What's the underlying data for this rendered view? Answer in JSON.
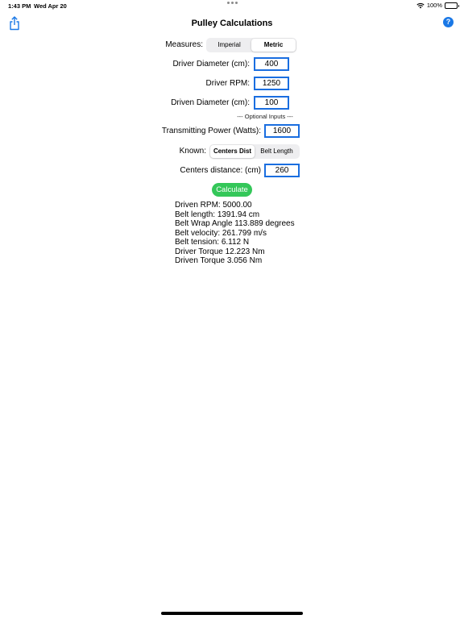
{
  "status": {
    "time": "1:43 PM",
    "date": "Wed Apr 20",
    "battery": "100%"
  },
  "nav": {
    "title": "Pulley Calculations",
    "help_label": "?"
  },
  "measures": {
    "label": "Measures:",
    "options": [
      "Imperial",
      "Metric"
    ],
    "selected": "Metric"
  },
  "inputs": {
    "driver_diameter": {
      "label": "Driver Diameter (cm):",
      "value": "400"
    },
    "driver_rpm": {
      "label": "Driver RPM:",
      "value": "1250"
    },
    "driven_diameter": {
      "label": "Driven Diameter (cm):",
      "value": "100"
    },
    "optional_note": "--- Optional Inputs ---",
    "transmitting_power": {
      "label": "Transmitting Power (Watts):",
      "value": "1600"
    }
  },
  "known": {
    "label": "Known:",
    "options": [
      "Centers Dist",
      "Belt Length"
    ],
    "selected": "Centers Dist"
  },
  "centers_distance": {
    "label": "Centers distance: (cm)",
    "value": "260"
  },
  "calculate_label": "Calculate",
  "results": [
    "Driven RPM: 5000.00",
    "Belt length: 1391.94 cm",
    "Belt Wrap Angle 113.889 degrees",
    "Belt velocity: 261.799 m/s",
    "Belt tension: 6.112 N",
    "Driver Torque 12.223 Nm",
    "Driven Torque 3.056 Nm"
  ],
  "colors": {
    "accent": "#1a6ee0",
    "calculate_button": "#34c759"
  },
  "icons": {
    "share": "share-icon",
    "help": "help-icon",
    "wifi": "wifi-icon",
    "battery": "battery-icon"
  }
}
